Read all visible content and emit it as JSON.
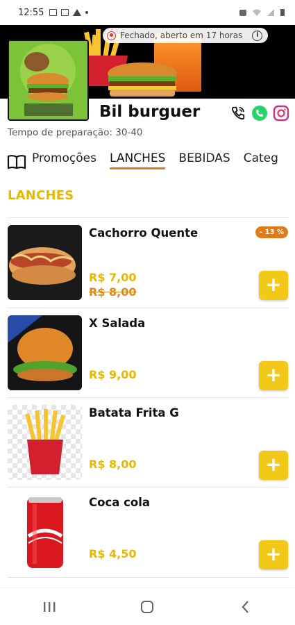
{
  "status_bar": {
    "time": "12:55"
  },
  "banner": {
    "closed_notice": "Fechado, aberto em 17 horas"
  },
  "store": {
    "name": "Bil burguer",
    "prep_time": "Tempo de preparação: 30-40"
  },
  "tabs": [
    {
      "label": "Promoções",
      "active": false
    },
    {
      "label": "LANCHES",
      "active": true
    },
    {
      "label": "BEBIDAS",
      "active": false
    },
    {
      "label": "Categ",
      "active": false
    }
  ],
  "section": {
    "title": "LANCHES"
  },
  "products": [
    {
      "name": "Cachorro Quente",
      "price": "R$ 7,00",
      "old_price": "R$ 8,00",
      "discount": "- 13 %"
    },
    {
      "name": "X Salada",
      "price": "R$ 9,00"
    },
    {
      "name": "Batata Frita G",
      "price": "R$ 8,00"
    },
    {
      "name": "Coca cola",
      "price": "R$ 4,50"
    }
  ],
  "add_button": {
    "label": "+"
  },
  "colors": {
    "accent_yellow": "#f2c919",
    "price_yellow": "#e6b800",
    "discount_orange": "#e07b17",
    "tab_underline": "#e07b17",
    "whatsapp_green": "#25d366"
  },
  "icons": {
    "menu": "book-icon",
    "phone": "phone-icon",
    "whatsapp": "whatsapp-icon",
    "instagram": "instagram-icon",
    "closed": "record-icon",
    "info": "info-icon"
  }
}
